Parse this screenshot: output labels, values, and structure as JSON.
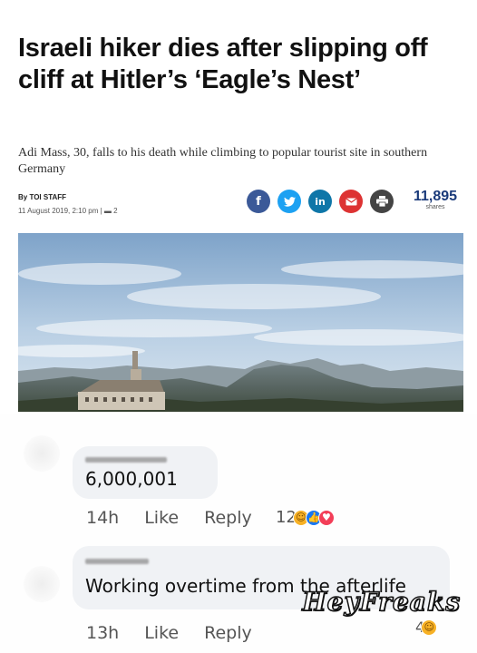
{
  "article": {
    "headline": "Israeli hiker dies after slipping off cliff at Hitler’s ‘Eagle’s Nest’",
    "subheadline": "Adi Mass, 30, falls to his death while climbing to popular tourist site in southern Germany",
    "author": "By TOI STAFF",
    "date_meta": "11 August 2019, 2:10 pm  |  ▬ 2",
    "share_count": "11,895",
    "share_label": "shares",
    "share_icons": [
      "facebook-icon",
      "twitter-icon",
      "linkedin-icon",
      "email-icon",
      "print-icon"
    ]
  },
  "comments": [
    {
      "text": "6,000,001",
      "time": "14h",
      "like_label": "Like",
      "reply_label": "Reply",
      "reaction_count": "12",
      "reactions": [
        "haha-icon",
        "like-icon",
        "love-icon"
      ]
    },
    {
      "text": "Working overtime from the afterlife",
      "time": "13h",
      "like_label": "Like",
      "reply_label": "Reply",
      "reaction_count": "4",
      "reactions": [
        "haha-icon"
      ]
    }
  ],
  "watermark": "HeyFreaks",
  "colors": {
    "facebook": "#3b5998",
    "twitter": "#1da1f2",
    "linkedin": "#0e76a8",
    "email": "#dd3333",
    "print": "#444444",
    "bubble": "#f0f2f5"
  }
}
